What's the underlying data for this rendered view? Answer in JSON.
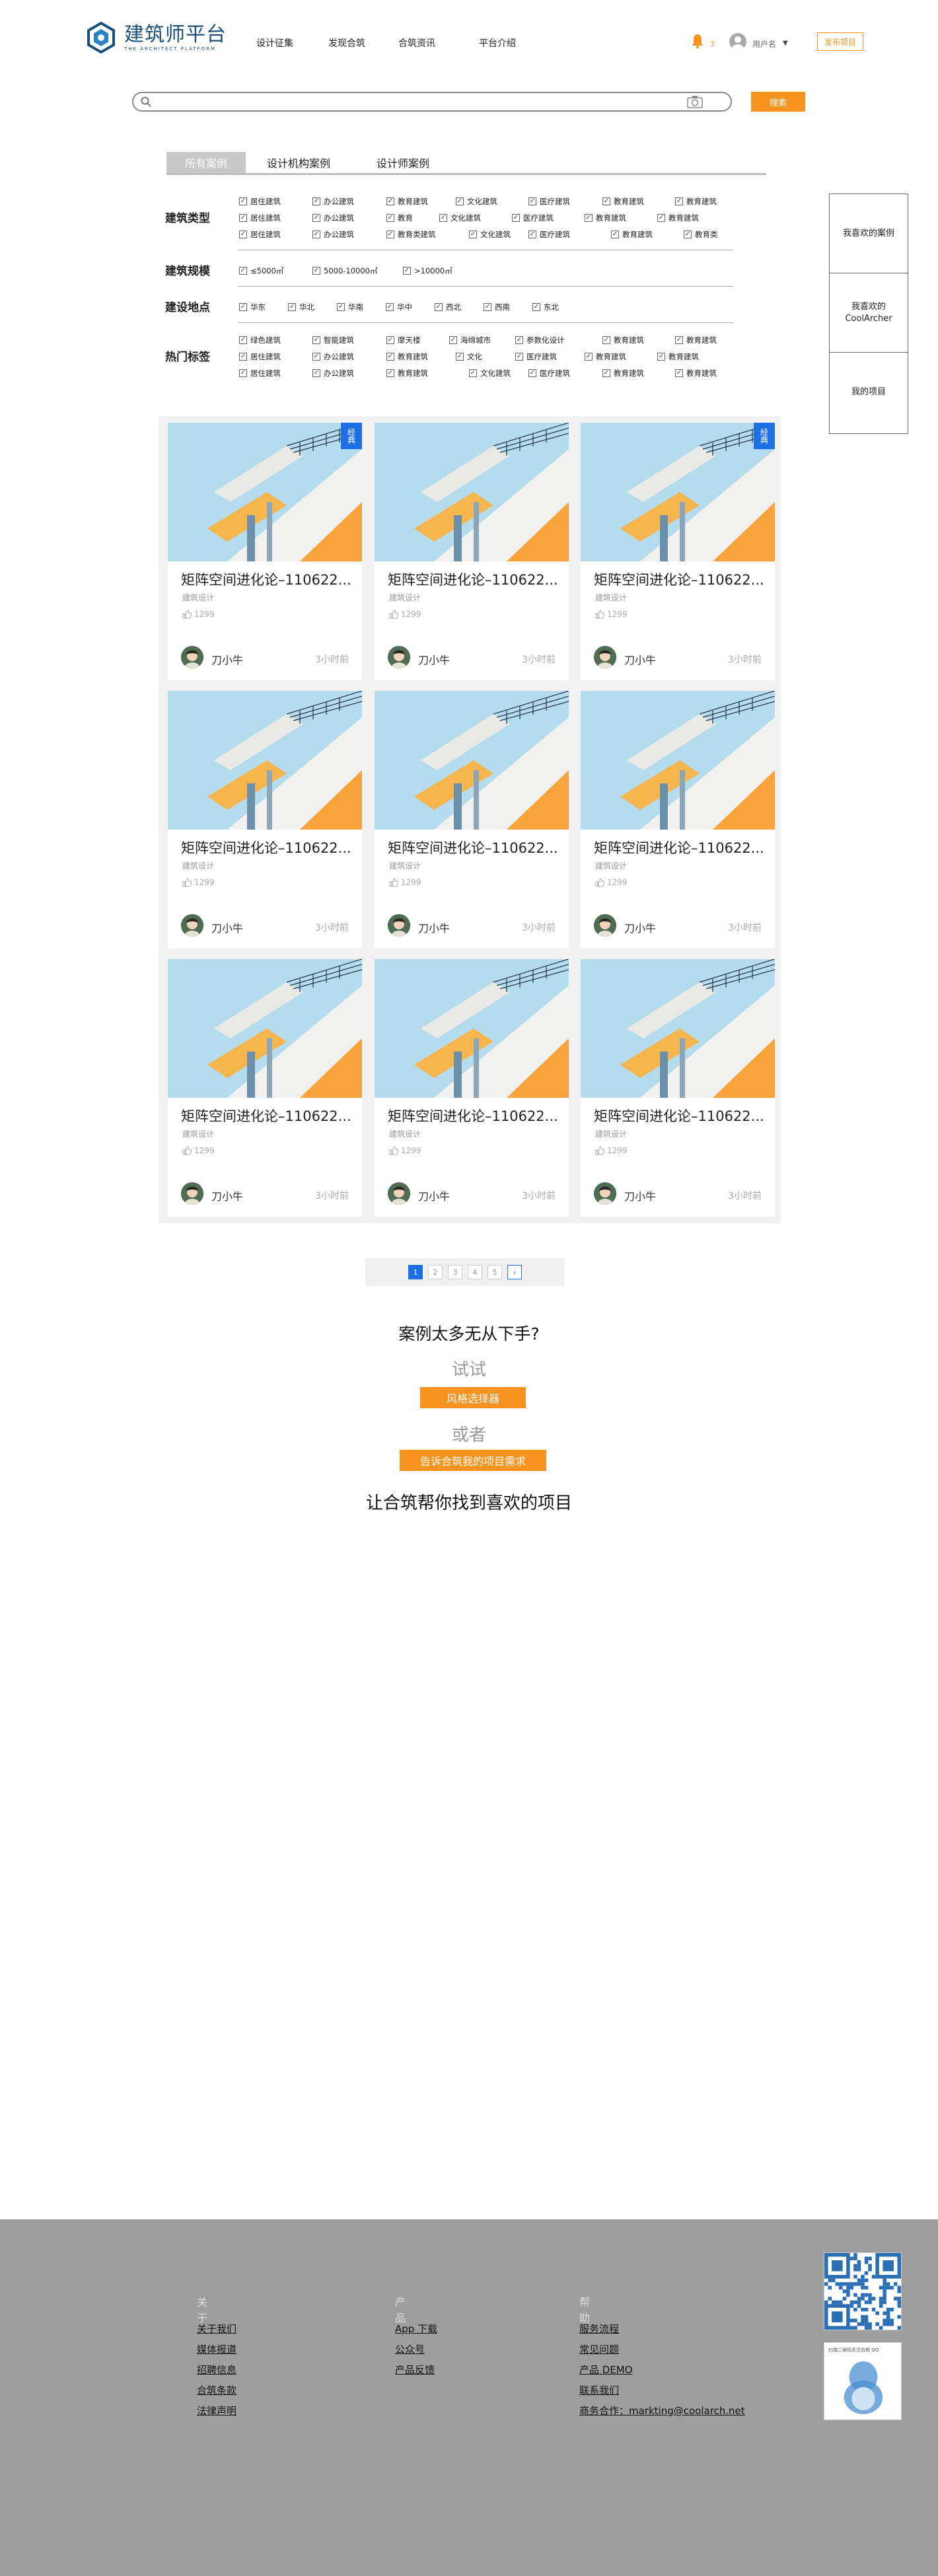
{
  "header": {
    "logo_text": "建筑师平台",
    "logo_sub": "THE ARCHITECT PLATFORM",
    "nav": [
      "设计征集",
      "发现合筑",
      "合筑资讯",
      "平台介绍"
    ],
    "notification_count": "3",
    "username": "用户名",
    "publish_label": "发布项目",
    "accent_color": "#f7931e"
  },
  "search": {
    "placeholder": "",
    "button_label": "搜索"
  },
  "tabs": [
    "所有案例",
    "设计机构案例",
    "设计师案例"
  ],
  "filters": {
    "type": {
      "label": "建筑类型",
      "rows": [
        [
          "居住建筑",
          "办公建筑",
          "教育建筑",
          "文化建筑",
          "医疗建筑",
          "教育建筑",
          "教育建筑"
        ],
        [
          "居住建筑",
          "办公建筑",
          "教育",
          "文化建筑",
          "医疗建筑",
          "教育建筑",
          "教育建筑"
        ],
        [
          "居住建筑",
          "办公建筑",
          "教育类建筑",
          "文化建筑",
          "医疗建筑",
          "教育建筑",
          "教育类"
        ]
      ]
    },
    "scale": {
      "label": "建筑规模",
      "options": [
        "≤5000㎡",
        "5000-10000㎡",
        ">10000㎡"
      ]
    },
    "location": {
      "label": "建设地点",
      "options": [
        "华东",
        "华北",
        "华南",
        "华中",
        "西北",
        "西南",
        "东北"
      ]
    },
    "tags": {
      "label": "热门标签",
      "rows": [
        [
          "绿色建筑",
          "智能建筑",
          "摩天楼",
          "海绵城市",
          "参数化设计",
          "教育建筑",
          "教育建筑"
        ],
        [
          "居住建筑",
          "办公建筑",
          "教育建筑",
          "文化",
          "医疗建筑",
          "教育建筑",
          "教育建筑"
        ],
        [
          "居住建筑",
          "办公建筑",
          "教育建筑",
          "文化建筑",
          "医疗建筑",
          "教育建筑",
          "教育建筑"
        ]
      ]
    }
  },
  "side_panel": [
    "我喜欢的案例",
    "我喜欢的CoolArcher",
    "我的项目"
  ],
  "cards": [
    {
      "badge": "经典",
      "title": "矩阵空间进化论–110622...",
      "category": "建筑设计",
      "likes": "1299",
      "author": "刀小牛",
      "time": "3小时前"
    },
    {
      "badge": "",
      "title": "矩阵空间进化论–110622...",
      "category": "建筑设计",
      "likes": "1299",
      "author": "刀小牛",
      "time": "3小时前"
    },
    {
      "badge": "经典",
      "title": "矩阵空间进化论–110622...",
      "category": "建筑设计",
      "likes": "1299",
      "author": "刀小牛",
      "time": "3小时前"
    },
    {
      "badge": "",
      "title": "矩阵空间进化论–110622...",
      "category": "建筑设计",
      "likes": "1299",
      "author": "刀小牛",
      "time": "3小时前"
    },
    {
      "badge": "",
      "title": "矩阵空间进化论–110622...",
      "category": "建筑设计",
      "likes": "1299",
      "author": "刀小牛",
      "time": "3小时前"
    },
    {
      "badge": "",
      "title": "矩阵空间进化论–110622...",
      "category": "建筑设计",
      "likes": "1299",
      "author": "刀小牛",
      "time": "3小时前"
    },
    {
      "badge": "",
      "title": "矩阵空间进化论–110622...",
      "category": "建筑设计",
      "likes": "1299",
      "author": "刀小牛",
      "time": "3小时前"
    },
    {
      "badge": "",
      "title": "矩阵空间进化论–110622...",
      "category": "建筑设计",
      "likes": "1299",
      "author": "刀小牛",
      "time": "3小时前"
    },
    {
      "badge": "",
      "title": "矩阵空间进化论–110622...",
      "category": "建筑设计",
      "likes": "1299",
      "author": "刀小牛",
      "time": "3小时前"
    }
  ],
  "pagination": {
    "pages": [
      "1",
      "2",
      "3",
      "4",
      "5"
    ],
    "current": "1",
    "next": "›"
  },
  "cta": {
    "question": "案例太多无从下手?",
    "try_label": "试试",
    "style_button": "风格选择器",
    "or_label": "或者",
    "demand_button": "告诉合筑我的项目需求",
    "closing": "让合筑帮你找到喜欢的项目"
  },
  "footer": {
    "columns": [
      {
        "heading": "关于",
        "links": [
          "关于我们",
          "媒体报道",
          "招聘信息",
          "合筑条款",
          "法律声明"
        ]
      },
      {
        "heading": "产品",
        "links": [
          "App 下载",
          "公众号",
          "产品反馈"
        ]
      },
      {
        "heading": "帮助",
        "links": [
          "服务流程",
          "常见问题",
          "产品 DEMO",
          "联系我们",
          "商务合作：markting@coolarch.net"
        ]
      }
    ],
    "qr_caption": "扫描二维码关注合筑 QQ"
  }
}
